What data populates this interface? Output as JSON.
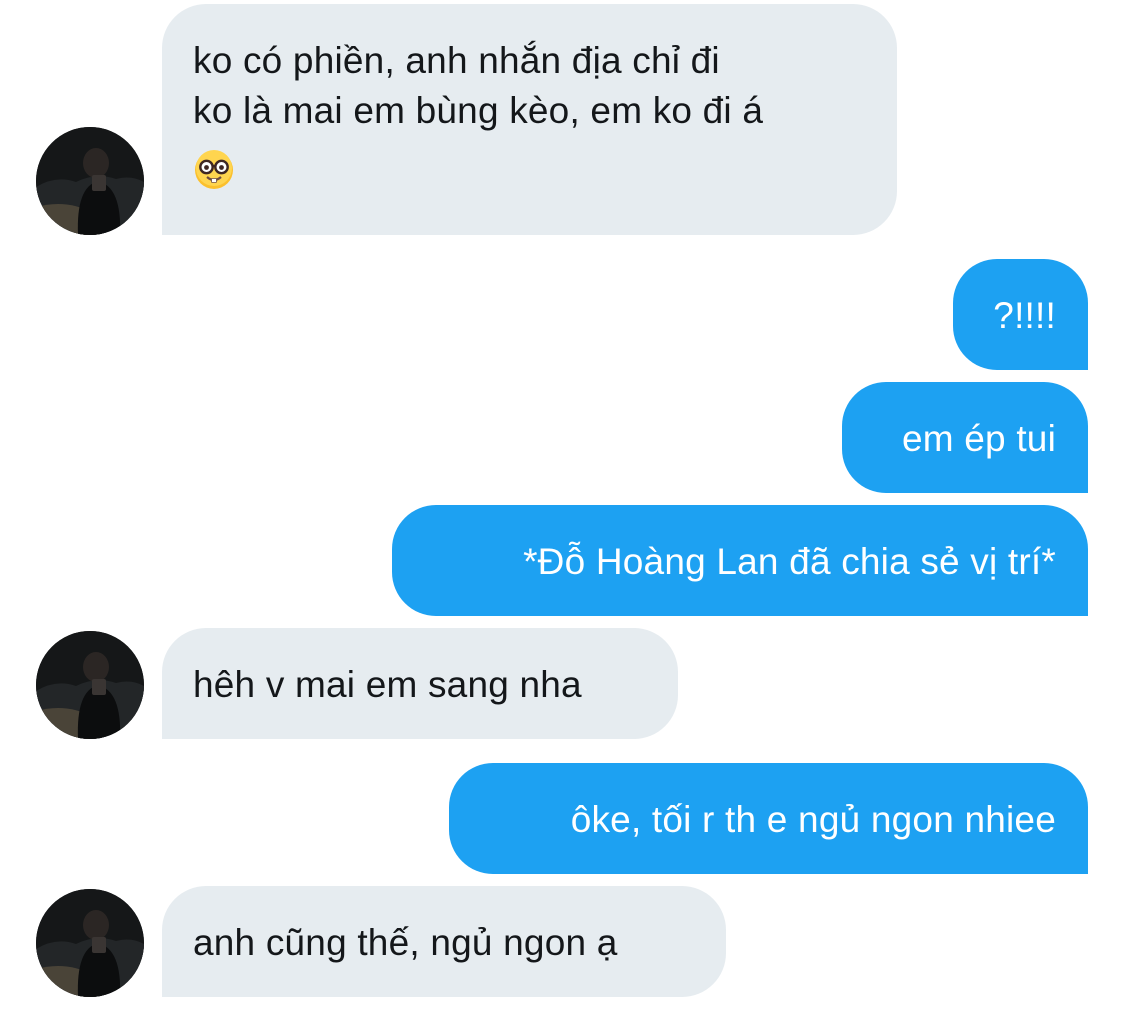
{
  "messages": [
    {
      "sender": "other",
      "lines": [
        "ko có phiền, anh nhắn địa chỉ đi",
        "ko là mai em bùng kèo, em ko đi á"
      ],
      "emoji": "nerd-face-emoji"
    },
    {
      "sender": "me",
      "text": "?!!!!"
    },
    {
      "sender": "me",
      "text": "em ép tui"
    },
    {
      "sender": "me",
      "text": "*Đỗ Hoàng Lan đã chia sẻ vị trí*"
    },
    {
      "sender": "other",
      "text": "hêh v mai em sang nha"
    },
    {
      "sender": "me",
      "text": "ôke, tối r th e ngủ ngon nhiee"
    },
    {
      "sender": "other",
      "text": "anh cũng thế, ngủ ngon ạ"
    }
  ],
  "colors": {
    "outgoing_bubble": "#1da1f2",
    "incoming_bubble": "#e6ecf0",
    "incoming_text": "#14171a",
    "outgoing_text": "#ffffff",
    "background": "#ffffff"
  }
}
